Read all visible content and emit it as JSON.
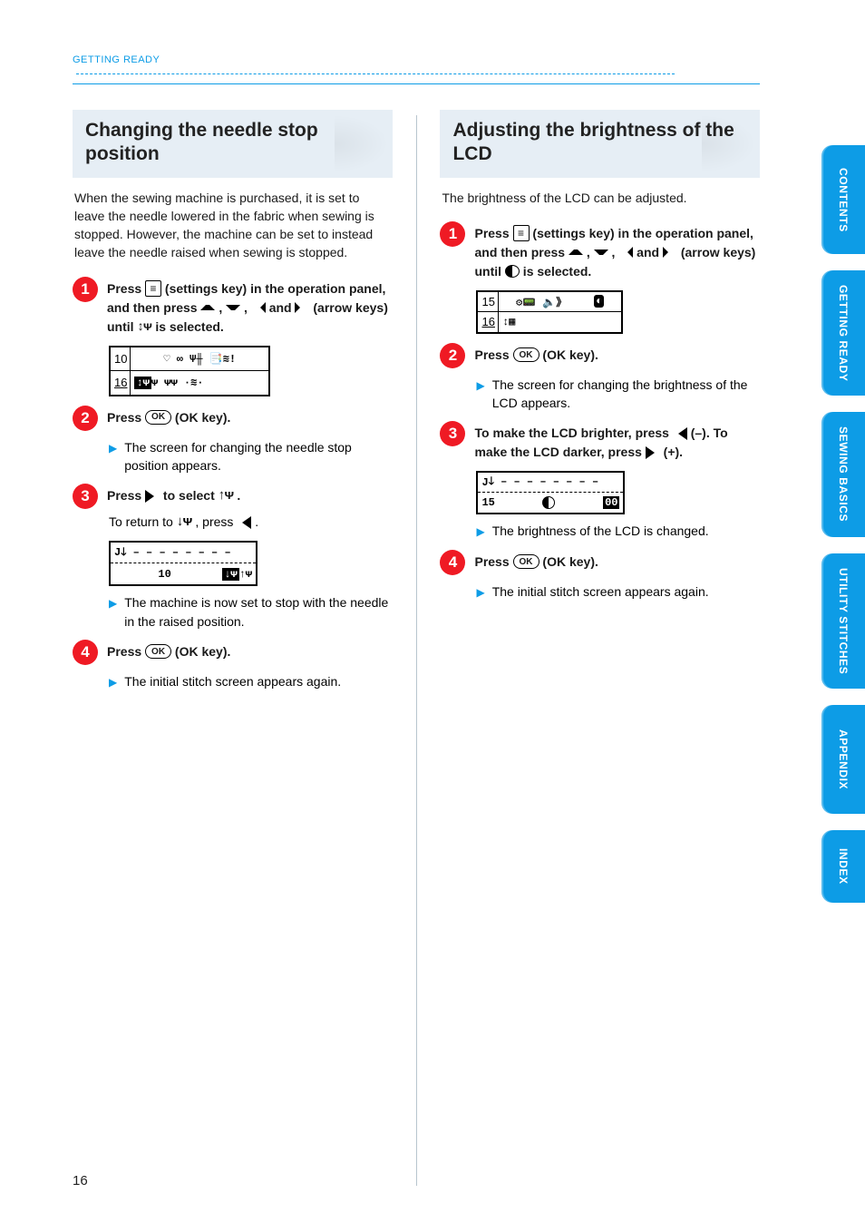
{
  "header": {
    "section": "GETTING READY"
  },
  "page_number": "16",
  "sidenav": [
    {
      "label": "CONTENTS"
    },
    {
      "label": "GETTING READY"
    },
    {
      "label": "SEWING BASICS"
    },
    {
      "label": "UTILITY STITCHES"
    },
    {
      "label": "APPENDIX"
    },
    {
      "label": "INDEX"
    }
  ],
  "left": {
    "title": "Changing the needle stop position",
    "intro": "When the sewing machine is purchased, it is set to leave the needle lowered in the fabric when sewing is stopped. However, the machine can be set to instead leave the needle raised when sewing is stopped.",
    "step1a": "Press ",
    "step1b": " (settings key) in the operation panel, and then press ",
    "step1c": " , ",
    "step1d": " , ",
    "step1e": " and ",
    "step1f": " (arrow keys) until ",
    "step1g": " is selected.",
    "lcd1": {
      "frac_top": "10",
      "frac_bot": "16"
    },
    "step2a": "Press ",
    "step2b": " (OK key).",
    "result2": "The screen for changing the needle stop position appears.",
    "step3a": "Press ",
    "step3b": " to select ",
    "step3c": " .",
    "step3d": "To return to ",
    "step3e": " , press ",
    "step3f": " .",
    "lcd2": {
      "row1": "J",
      "row2": "10"
    },
    "result3": "The machine is now set to stop with the needle in the raised position.",
    "step4a": "Press ",
    "step4b": " (OK key).",
    "result4": "The initial stitch screen appears again."
  },
  "right": {
    "title": "Adjusting the brightness of the LCD",
    "intro": "The brightness of the LCD can be adjusted.",
    "step1a": "Press ",
    "step1b": " (settings key) in the operation panel, and then press ",
    "step1c": " , ",
    "step1d": " , ",
    "step1e": " and ",
    "step1f": " (arrow keys) until ",
    "step1g": " is selected.",
    "lcd1": {
      "frac_top": "15",
      "frac_bot": "16"
    },
    "step2a": "Press ",
    "step2b": " (OK key).",
    "result2": "The screen for changing the brightness of the LCD appears.",
    "step3a": "To make the LCD brighter, press ",
    "step3b": " (–). To make the LCD darker, press ",
    "step3c": " (+).",
    "lcd2": {
      "row1": "J",
      "row2": "15",
      "val": "00"
    },
    "result3": "The brightness of the LCD is changed.",
    "step4a": "Press ",
    "step4b": " (OK key).",
    "result4": "The initial stitch screen appears again."
  }
}
